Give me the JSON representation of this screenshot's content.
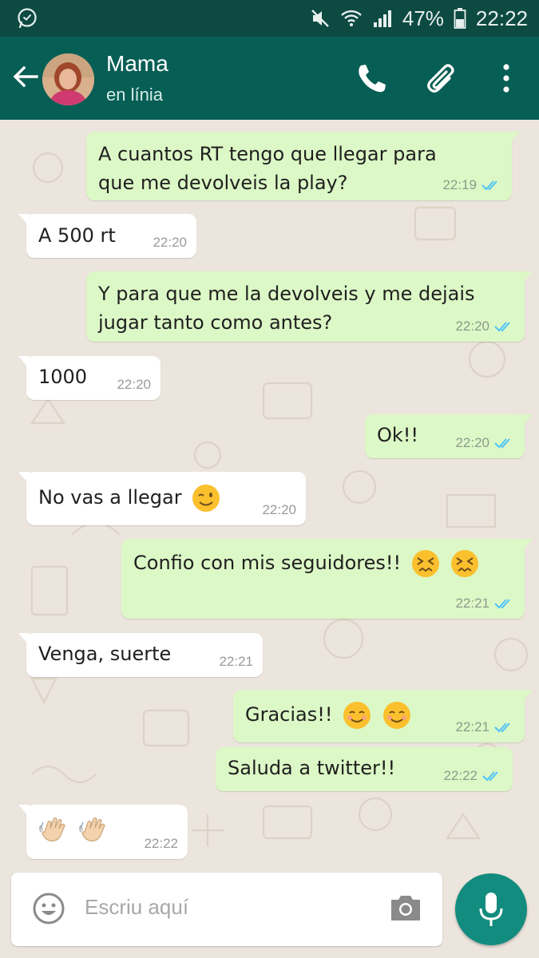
{
  "status_bar": {
    "battery": "47%",
    "time": "22:22"
  },
  "contact": {
    "name": "Mama",
    "status": "en línia"
  },
  "messages": [
    {
      "dir": "out",
      "text_lines": [
        "A cuantos RT tengo que llegar para",
        "que me devolveis la play?"
      ],
      "time": "22:19"
    },
    {
      "dir": "in",
      "text": "A 500 rt",
      "time": "22:20"
    },
    {
      "dir": "out",
      "text_lines": [
        "Y para que me la devolveis y me dejais",
        "jugar tanto como antes?"
      ],
      "time": "22:20"
    },
    {
      "dir": "in",
      "text": "1000",
      "time": "22:20"
    },
    {
      "dir": "out",
      "text": "Ok!!",
      "time": "22:20"
    },
    {
      "dir": "in",
      "text": "No vas a llegar",
      "emojis": [
        "winking-face"
      ],
      "time": "22:20"
    },
    {
      "dir": "out",
      "text": "Confio con mis seguidores!!",
      "emojis": [
        "confounded-face",
        "confounded-face"
      ],
      "time": "22:21"
    },
    {
      "dir": "in",
      "text": "Venga, suerte",
      "time": "22:21"
    },
    {
      "dir": "out",
      "text": "Gracias!!",
      "emojis": [
        "smiling-face",
        "smiling-face"
      ],
      "time": "22:21"
    },
    {
      "dir": "out",
      "text": "Saluda a twitter!!",
      "time": "22:22"
    },
    {
      "dir": "in",
      "text": "",
      "emojis": [
        "waving-hand",
        "waving-hand"
      ],
      "time": "22:22"
    }
  ],
  "composer": {
    "placeholder": "Escriu aquí"
  },
  "colors": {
    "header": "#075e54",
    "status_bar": "#0d4a42",
    "outgoing": "#dcf8c6",
    "incoming": "#ffffff",
    "read_ticks": "#4fc3f7",
    "fab": "#128c7e"
  }
}
